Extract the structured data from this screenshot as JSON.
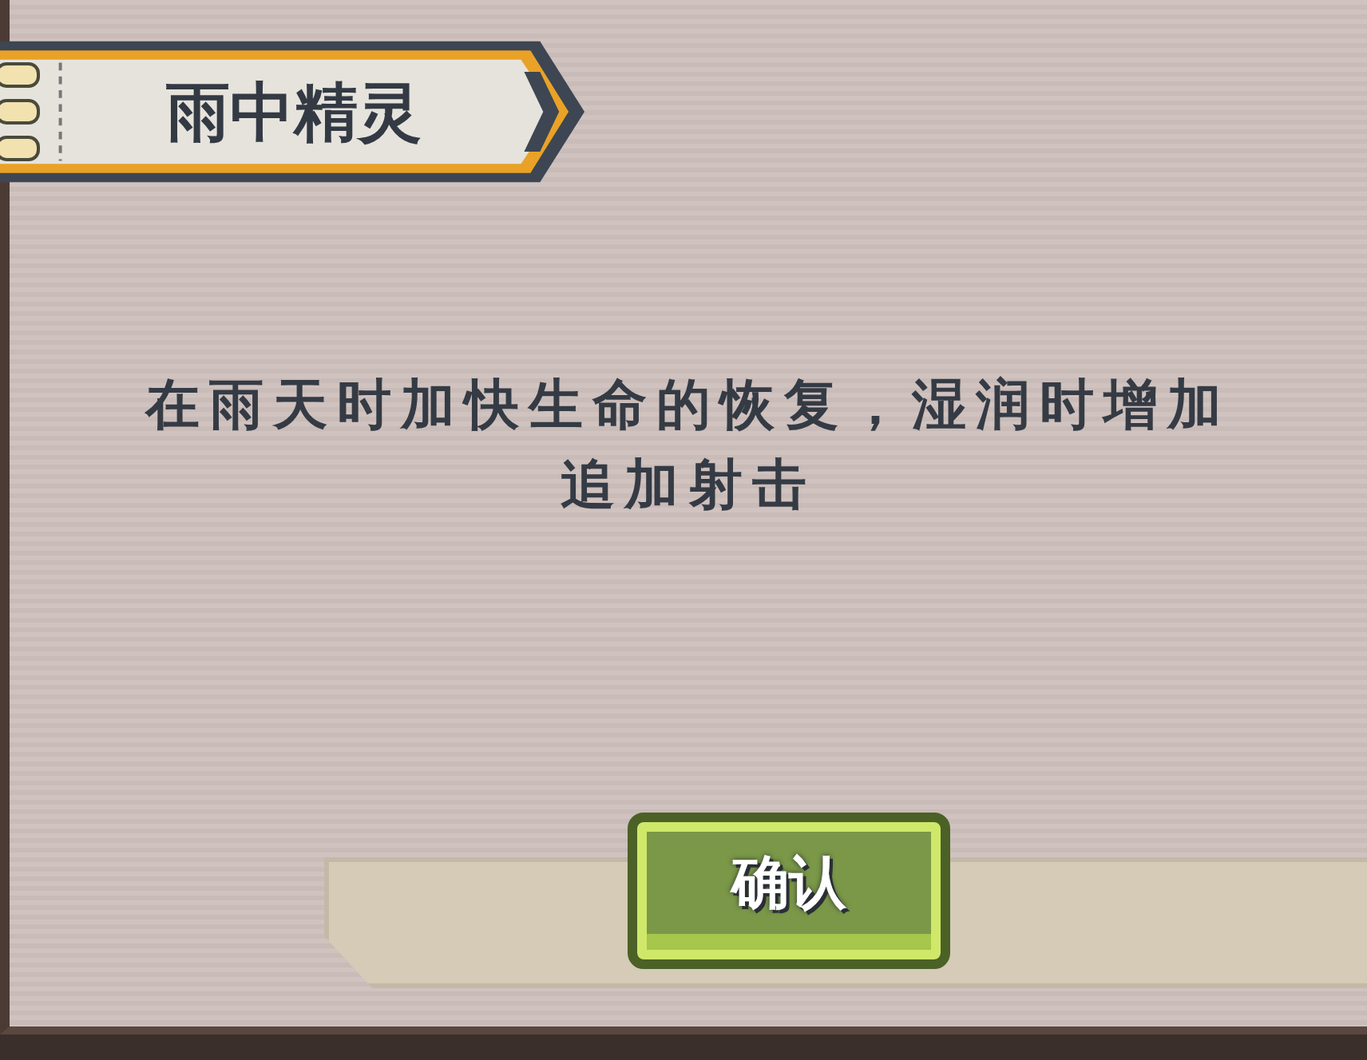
{
  "dialog": {
    "title": "雨中精灵",
    "description": "在雨天时加快生命的恢复，湿润时增加追加射击",
    "buttons": [
      {
        "label": "确认",
        "kind": "primary"
      }
    ]
  }
}
